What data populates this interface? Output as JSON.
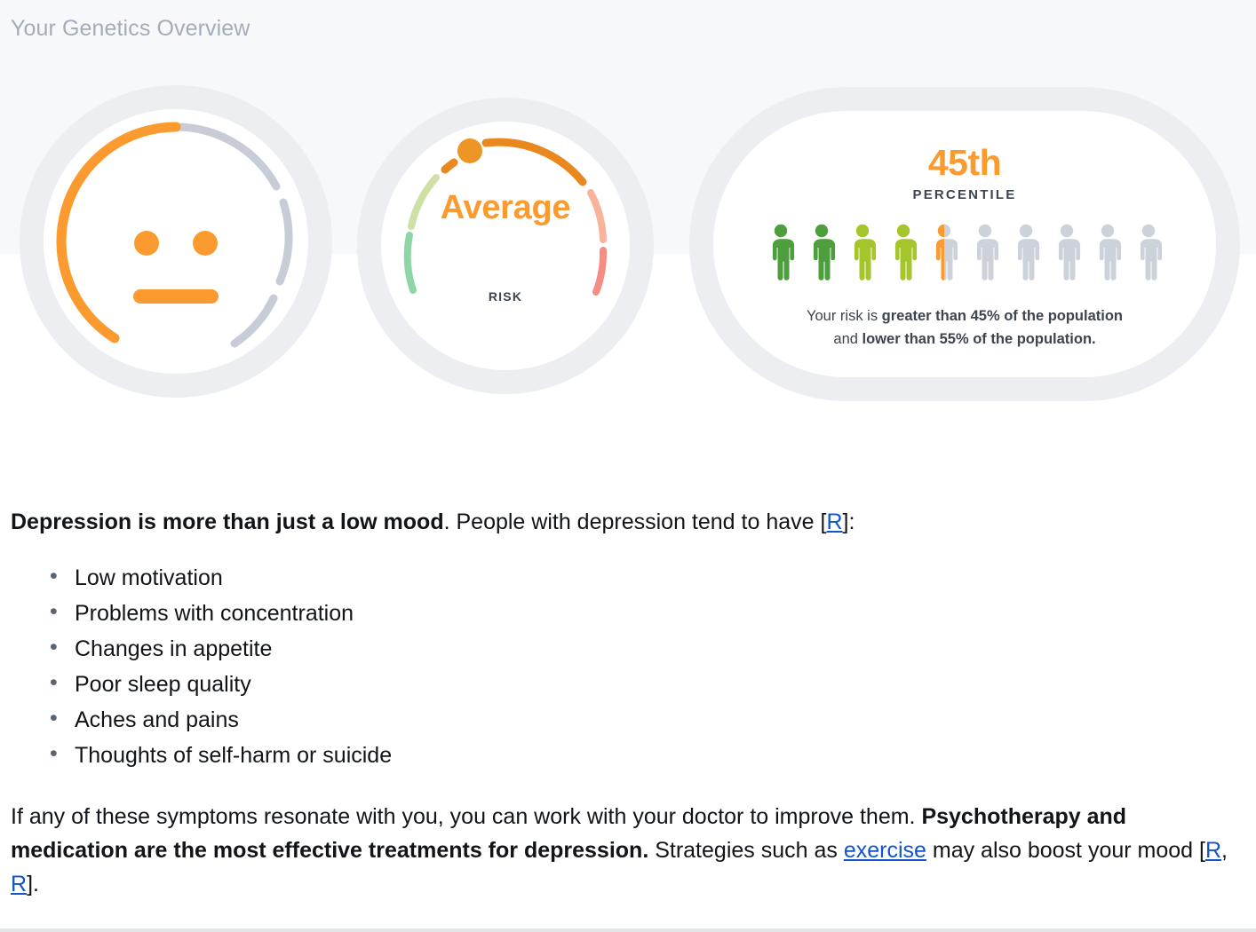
{
  "header": {
    "title": "Your Genetics Overview"
  },
  "colors": {
    "accent_orange": "#fb9a2e",
    "arc_orange": "#e8881f",
    "track_grey": "#c8ccd6",
    "card_ring": "#eceef2",
    "band_bg": "#f7f8fa",
    "green_dark": "#4e9e3e",
    "green_light": "#a4c62c",
    "person_grey": "#ccd1da",
    "text_dark": "#3c4450",
    "link_blue": "#1155cc",
    "gauge_green": "#8fd6a6",
    "gauge_green_pale": "#cfe0a6",
    "gauge_salmon": "#f9b39a",
    "gauge_red": "#f58d85"
  },
  "mood_gauge": {
    "icon": "neutral-face-icon",
    "filled_pct": 45,
    "filled_color": "#fb9a2e",
    "track_color": "#c8ccd6",
    "expression": "neutral"
  },
  "risk_gauge": {
    "value_label": "Average",
    "caption": "RISK",
    "marker": "risk-pointer-dot",
    "marker_position_pct": 45,
    "segments": [
      {
        "name": "low",
        "color": "#8fd6a6"
      },
      {
        "name": "below-avg",
        "color": "#cfe0a6"
      },
      {
        "name": "average",
        "color": "#e8881f"
      },
      {
        "name": "above-avg",
        "color": "#f9b39a"
      },
      {
        "name": "high",
        "color": "#f58d85"
      }
    ]
  },
  "percentile": {
    "value": "45th",
    "label": "PERCENTILE",
    "people_total": 10,
    "people_filled": 4.5,
    "people": [
      {
        "fill": "full",
        "color": "#4e9e3e"
      },
      {
        "fill": "full",
        "color": "#4e9e3e"
      },
      {
        "fill": "full",
        "color": "#a4c62c"
      },
      {
        "fill": "full",
        "color": "#a4c62c"
      },
      {
        "fill": "half",
        "color": "#fb9a2e"
      },
      {
        "fill": "none",
        "color": "#ccd1da"
      },
      {
        "fill": "none",
        "color": "#ccd1da"
      },
      {
        "fill": "none",
        "color": "#ccd1da"
      },
      {
        "fill": "none",
        "color": "#ccd1da"
      },
      {
        "fill": "none",
        "color": "#ccd1da"
      }
    ],
    "description": {
      "line1_prefix": "Your risk is ",
      "line1_bold": "greater than 45% of the population",
      "line2_prefix": "and ",
      "line2_bold": "lower than 55% of the population."
    }
  },
  "article": {
    "lead": {
      "bold": "Depression is more than just a low mood",
      "rest": ". People with depression tend to have [",
      "ref": "R",
      "tail": "]:"
    },
    "symptoms": [
      "Low motivation",
      "Problems with concentration",
      "Changes in appetite",
      "Poor sleep quality",
      "Aches and pains",
      "Thoughts of self-harm or suicide"
    ],
    "closing": {
      "part1": "If any of these symptoms resonate with you, you can work with your doctor to improve them. ",
      "bold": "Psychotherapy and medication are the most effective treatments for depression.",
      "part2": " Strategies such as ",
      "link": "exercise",
      "part3": " may also boost your mood [",
      "ref1": "R",
      "sep": ", ",
      "ref2": "R",
      "part4": "]."
    }
  }
}
